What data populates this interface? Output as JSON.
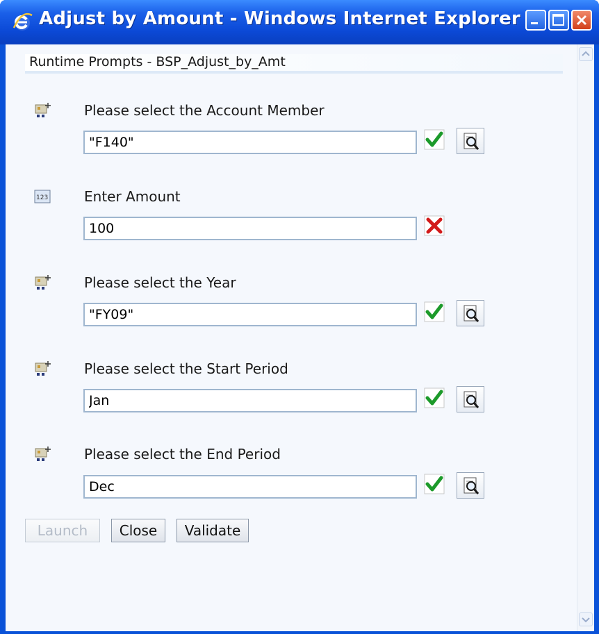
{
  "window": {
    "title": "Adjust by Amount - Windows Internet Explorer"
  },
  "header": {
    "title": "Runtime Prompts - BSP_Adjust_by_Amt"
  },
  "prompts": [
    {
      "label": "Please select the Account Member",
      "value": "\"F140\"",
      "type_icon": "member-selection-icon",
      "status": "valid",
      "has_lookup": true
    },
    {
      "label": "Enter Amount",
      "value": "100",
      "type_icon": "numeric-icon",
      "status": "invalid",
      "has_lookup": false
    },
    {
      "label": "Please select the Year",
      "value": "\"FY09\"",
      "type_icon": "member-selection-icon",
      "status": "valid",
      "has_lookup": true
    },
    {
      "label": "Please select the Start Period",
      "value": "Jan",
      "type_icon": "member-selection-icon",
      "status": "valid",
      "has_lookup": true
    },
    {
      "label": "Please select the End Period",
      "value": "Dec",
      "type_icon": "member-selection-icon",
      "status": "valid",
      "has_lookup": true
    }
  ],
  "buttons": {
    "launch": "Launch",
    "close": "Close",
    "validate": "Validate"
  },
  "icons": {
    "number_icon_text": "123"
  },
  "colors": {
    "titlebar": "#0b49d6",
    "valid_check": "#1c9a2a",
    "invalid_x": "#d21a1a"
  }
}
